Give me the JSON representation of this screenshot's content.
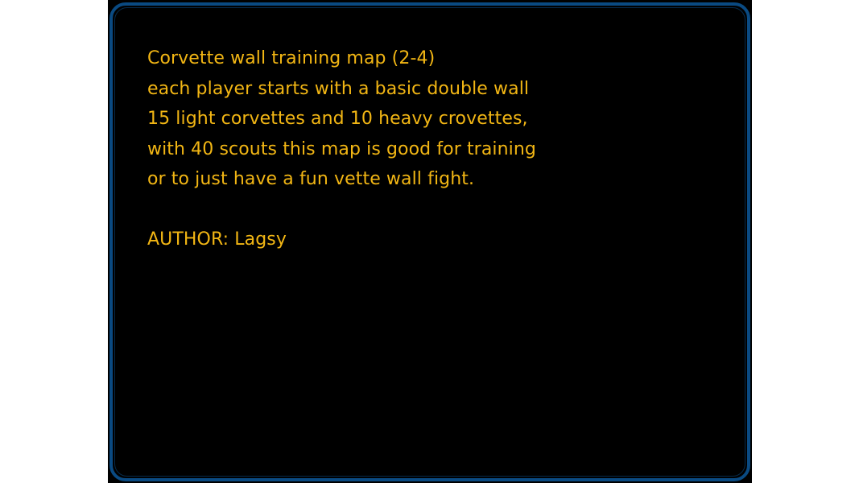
{
  "map_description": {
    "lines": [
      "Corvette wall training map (2-4)",
      "each player starts with a basic double wall",
      "15 light corvettes and 10 heavy crovettes,",
      "with 40 scouts this map is good for training",
      "or to just have a fun vette wall fight."
    ],
    "author_line": "AUTHOR: Lagsy"
  },
  "colors": {
    "text": "#f2b614",
    "frame": "#0a4a82",
    "panel_background": "#000000"
  }
}
